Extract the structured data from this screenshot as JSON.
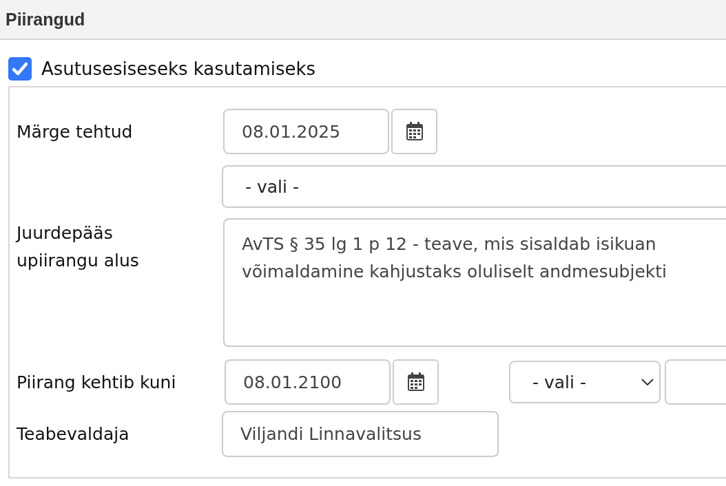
{
  "section": {
    "title": "Piirangud"
  },
  "internal_use": {
    "label": "Asutusesiseseks kasutamiseks",
    "checked": true
  },
  "form": {
    "marked_on": {
      "label": "Märge tehtud",
      "value": "08.01.2025"
    },
    "basis_select": {
      "value": "- vali -"
    },
    "access_basis": {
      "label": "Juurdepääs upiirangu alus",
      "lines": [
        "AvTS § 35 lg 1 p 12 - teave, mis sisaldab isikuan",
        "võimaldamine kahjustaks oluliselt andmesubjekti"
      ]
    },
    "valid_until": {
      "label": "Piirang kehtib kuni",
      "value": "08.01.2100",
      "select": "- vali -"
    },
    "owner": {
      "label": "Teabevaldaja",
      "value": "Viljandi Linnavalitsus"
    }
  }
}
